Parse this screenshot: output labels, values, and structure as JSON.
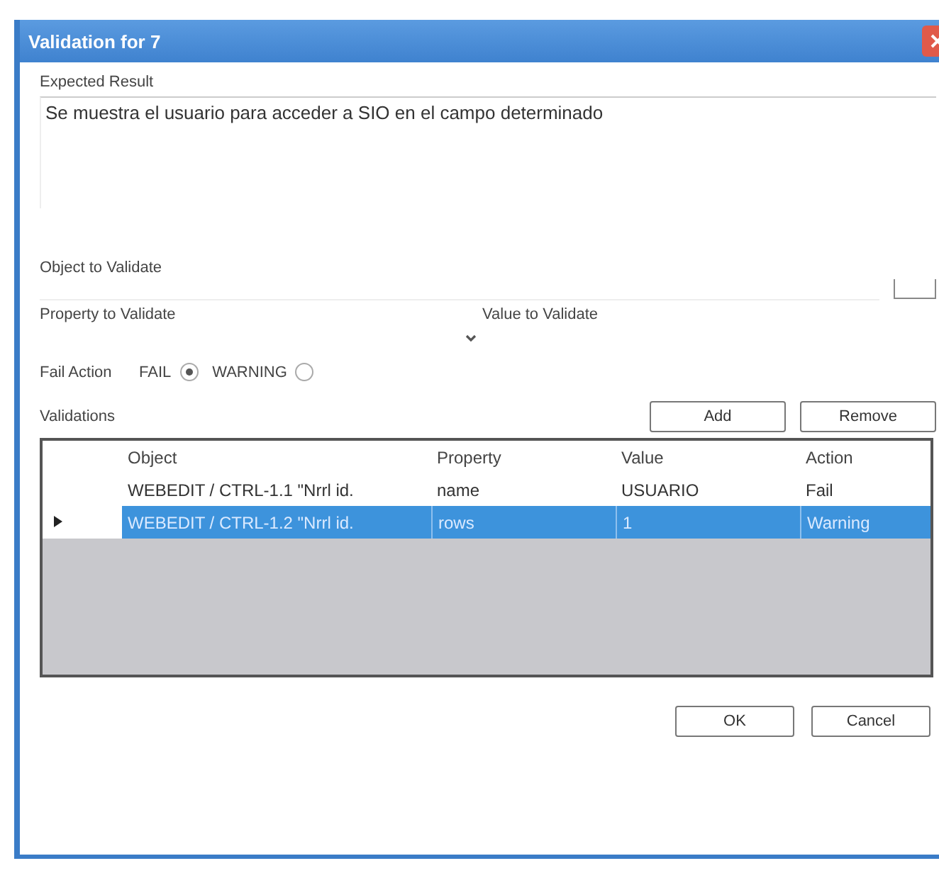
{
  "window": {
    "title": "Validation for 7"
  },
  "expected_result": {
    "label": "Expected Result",
    "value": "Se muestra el usuario para acceder a SIO en el campo determinado"
  },
  "object_to_validate": {
    "label": "Object to Validate"
  },
  "property_to_validate": {
    "label": "Property to Validate"
  },
  "value_to_validate": {
    "label": "Value to Validate"
  },
  "fail_action": {
    "label": "Fail Action",
    "options": [
      {
        "label": "FAIL",
        "selected": true
      },
      {
        "label": "WARNING",
        "selected": false
      }
    ]
  },
  "validations": {
    "label": "Validations",
    "buttons": [
      "Add",
      "Remove"
    ],
    "columns": [
      "Object",
      "Property",
      "Value",
      "Action"
    ],
    "rows": [
      {
        "cells": [
          "WEBEDIT / CTRL-1.1 \"Nrrl id.",
          "name",
          "USUARIO",
          "Fail"
        ],
        "selected": false
      },
      {
        "cells": [
          "WEBEDIT / CTRL-1.2 \"Nrrl id.",
          "rows",
          "1",
          "Warning"
        ],
        "selected": true
      }
    ]
  },
  "buttons": [
    "OK",
    "Cancel"
  ]
}
